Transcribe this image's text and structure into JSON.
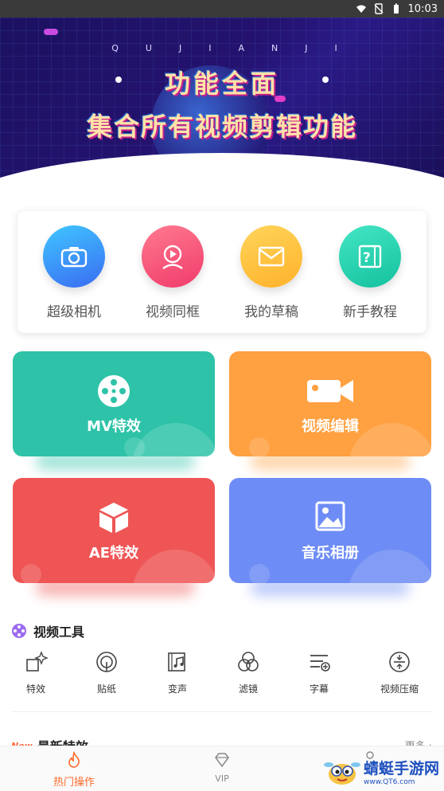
{
  "status_bar": {
    "time": "10:03"
  },
  "banner": {
    "letters": "QUJIANJI",
    "line1": "功能全面",
    "line2": "集合所有视频剪辑功能"
  },
  "quick_actions": [
    {
      "label": "超级相机",
      "icon": "camera-icon",
      "color_from": "#3fc6ff",
      "color_to": "#3a6cf2"
    },
    {
      "label": "视频同框",
      "icon": "video-person-icon",
      "color_from": "#ff7a8f",
      "color_to": "#f03b6b"
    },
    {
      "label": "我的草稿",
      "icon": "envelope-icon",
      "color_from": "#ffd45a",
      "color_to": "#ffb22b"
    },
    {
      "label": "新手教程",
      "icon": "help-book-icon",
      "color_from": "#44e6c5",
      "color_to": "#14c19e"
    }
  ],
  "features": [
    {
      "label": "MV特效",
      "icon": "film-reel-icon",
      "color": "#2ec3a8"
    },
    {
      "label": "视频编辑",
      "icon": "video-camera-icon",
      "color": "#ffa041"
    },
    {
      "label": "AE特效",
      "icon": "cube-icon",
      "color": "#ef5555"
    },
    {
      "label": "音乐相册",
      "icon": "image-icon",
      "color": "#6e8cf5"
    }
  ],
  "tools_section": {
    "title": "视频工具",
    "items": [
      {
        "label": "特效",
        "icon": "sparkle-icon"
      },
      {
        "label": "贴纸",
        "icon": "sticker-icon"
      },
      {
        "label": "变声",
        "icon": "music-film-icon"
      },
      {
        "label": "滤镜",
        "icon": "filter-icon"
      },
      {
        "label": "字幕",
        "icon": "subtitle-icon"
      },
      {
        "label": "视频压缩",
        "icon": "compress-icon"
      }
    ]
  },
  "latest": {
    "badge": "New",
    "title": "最新特效",
    "more": "更多 ›"
  },
  "bottom_nav": [
    {
      "label": "热门操作",
      "icon": "flame-icon",
      "active": true
    },
    {
      "label": "VIP",
      "icon": "diamond-icon",
      "active": false
    }
  ],
  "watermark": {
    "text": "蜻蜓手游网",
    "sub": "www.QT6.com"
  },
  "colors": {
    "accent": "#ff6a2b",
    "inactive": "#888888"
  }
}
